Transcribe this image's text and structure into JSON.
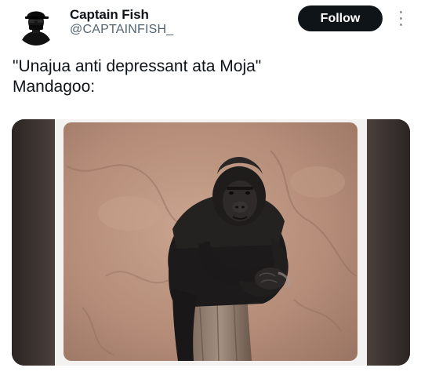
{
  "author": {
    "display_name": "Captain Fish",
    "handle": "@CAPTAINFISH_",
    "avatar_icon": "hooded-masked-figure-avatar"
  },
  "actions": {
    "follow_label": "Follow",
    "more_icon": "more-vertical-icon"
  },
  "tweet": {
    "lines": [
      "\"Unajua anti depressant ata Moja\"",
      "Mandagoo:"
    ]
  },
  "media": {
    "type": "photo",
    "subject": "gorilla-leaning-on-tree-stump"
  },
  "colors": {
    "text_primary": "#0f1419",
    "text_secondary": "#536471",
    "follow_button_bg": "#0f1419",
    "follow_button_text": "#ffffff"
  }
}
